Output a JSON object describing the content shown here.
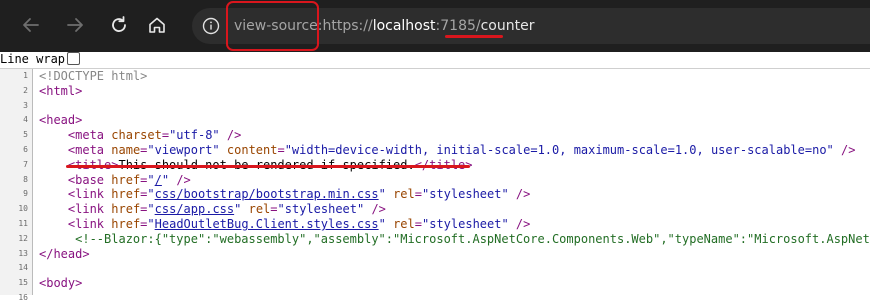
{
  "toolbar": {
    "back_label": "Back",
    "forward_label": "Forward",
    "refresh_label": "Refresh",
    "home_label": "Home"
  },
  "address_bar": {
    "scheme_prefix": "view-source:",
    "protocol": "https://",
    "host": "localhost",
    "port": ":7185",
    "path_sep": "/",
    "path": "counter"
  },
  "source_view": {
    "line_wrap_label": "Line wrap",
    "line_wrap_checked": false,
    "lines": [
      {
        "n": "1",
        "indent": "",
        "tokens": [
          {
            "t": "doctype",
            "v": "<!DOCTYPE html>"
          }
        ]
      },
      {
        "n": "2",
        "indent": "",
        "tokens": [
          {
            "t": "tag",
            "v": "<html>"
          }
        ]
      },
      {
        "n": "3",
        "indent": "",
        "tokens": []
      },
      {
        "n": "4",
        "indent": "",
        "tokens": [
          {
            "t": "tag",
            "v": "<head>"
          }
        ]
      },
      {
        "n": "5",
        "indent": "    ",
        "tokens": [
          {
            "t": "tag",
            "v": "<meta "
          },
          {
            "t": "attr",
            "v": "charset"
          },
          {
            "t": "tag",
            "v": "="
          },
          {
            "t": "val",
            "v": "\"utf-8\""
          },
          {
            "t": "tag",
            "v": " />"
          }
        ]
      },
      {
        "n": "6",
        "indent": "    ",
        "tokens": [
          {
            "t": "tag",
            "v": "<meta "
          },
          {
            "t": "attr",
            "v": "name"
          },
          {
            "t": "tag",
            "v": "="
          },
          {
            "t": "val",
            "v": "\"viewport\""
          },
          {
            "t": "tag",
            "v": " "
          },
          {
            "t": "attr",
            "v": "content"
          },
          {
            "t": "tag",
            "v": "="
          },
          {
            "t": "val",
            "v": "\"width=device-width, initial-scale=1.0, maximum-scale=1.0, user-scalable=no\""
          },
          {
            "t": "tag",
            "v": " />"
          }
        ]
      },
      {
        "n": "7",
        "indent": "    ",
        "tokens": [
          {
            "t": "tag",
            "v": "<title>"
          },
          {
            "t": "text",
            "v": "This should not be rendered if specified."
          },
          {
            "t": "tag",
            "v": "</title>"
          }
        ]
      },
      {
        "n": "8",
        "indent": "    ",
        "tokens": [
          {
            "t": "tag",
            "v": "<base "
          },
          {
            "t": "attr",
            "v": "href"
          },
          {
            "t": "tag",
            "v": "="
          },
          {
            "t": "val",
            "v": "\""
          },
          {
            "t": "link",
            "v": "/"
          },
          {
            "t": "val",
            "v": "\""
          },
          {
            "t": "tag",
            "v": " />"
          }
        ]
      },
      {
        "n": "9",
        "indent": "    ",
        "tokens": [
          {
            "t": "tag",
            "v": "<link "
          },
          {
            "t": "attr",
            "v": "href"
          },
          {
            "t": "tag",
            "v": "="
          },
          {
            "t": "val",
            "v": "\""
          },
          {
            "t": "link",
            "v": "css/bootstrap/bootstrap.min.css"
          },
          {
            "t": "val",
            "v": "\""
          },
          {
            "t": "tag",
            "v": " "
          },
          {
            "t": "attr",
            "v": "rel"
          },
          {
            "t": "tag",
            "v": "="
          },
          {
            "t": "val",
            "v": "\"stylesheet\""
          },
          {
            "t": "tag",
            "v": " />"
          }
        ]
      },
      {
        "n": "10",
        "indent": "    ",
        "tokens": [
          {
            "t": "tag",
            "v": "<link "
          },
          {
            "t": "attr",
            "v": "href"
          },
          {
            "t": "tag",
            "v": "="
          },
          {
            "t": "val",
            "v": "\""
          },
          {
            "t": "link",
            "v": "css/app.css"
          },
          {
            "t": "val",
            "v": "\""
          },
          {
            "t": "tag",
            "v": " "
          },
          {
            "t": "attr",
            "v": "rel"
          },
          {
            "t": "tag",
            "v": "="
          },
          {
            "t": "val",
            "v": "\"stylesheet\""
          },
          {
            "t": "tag",
            "v": " />"
          }
        ]
      },
      {
        "n": "11",
        "indent": "    ",
        "tokens": [
          {
            "t": "tag",
            "v": "<link "
          },
          {
            "t": "attr",
            "v": "href"
          },
          {
            "t": "tag",
            "v": "="
          },
          {
            "t": "val",
            "v": "\""
          },
          {
            "t": "link",
            "v": "HeadOutletBug.Client.styles.css"
          },
          {
            "t": "val",
            "v": "\""
          },
          {
            "t": "tag",
            "v": " "
          },
          {
            "t": "attr",
            "v": "rel"
          },
          {
            "t": "tag",
            "v": "="
          },
          {
            "t": "val",
            "v": "\"stylesheet\""
          },
          {
            "t": "tag",
            "v": " />"
          }
        ]
      },
      {
        "n": "12",
        "indent": "     ",
        "tokens": [
          {
            "t": "comment",
            "v": "<!--Blazor:{\"type\":\"webassembly\",\"assembly\":\"Microsoft.AspNetCore.Components.Web\",\"typeName\":\"Microsoft.AspNetCo"
          }
        ]
      },
      {
        "n": "13",
        "indent": "",
        "tokens": [
          {
            "t": "tag",
            "v": "</head>"
          }
        ]
      },
      {
        "n": "14",
        "indent": "",
        "tokens": []
      },
      {
        "n": "15",
        "indent": "",
        "tokens": [
          {
            "t": "tag",
            "v": "<body>"
          }
        ]
      },
      {
        "n": "16",
        "indent": "",
        "tokens": []
      }
    ]
  },
  "colors": {
    "toolbar_bg": "#1f1f1f",
    "address_bg": "#2d2d2d",
    "annotation_red": "#d9161d",
    "tag": "#881280",
    "attr": "#994500",
    "value": "#1a1aa6",
    "comment": "#236e25"
  }
}
